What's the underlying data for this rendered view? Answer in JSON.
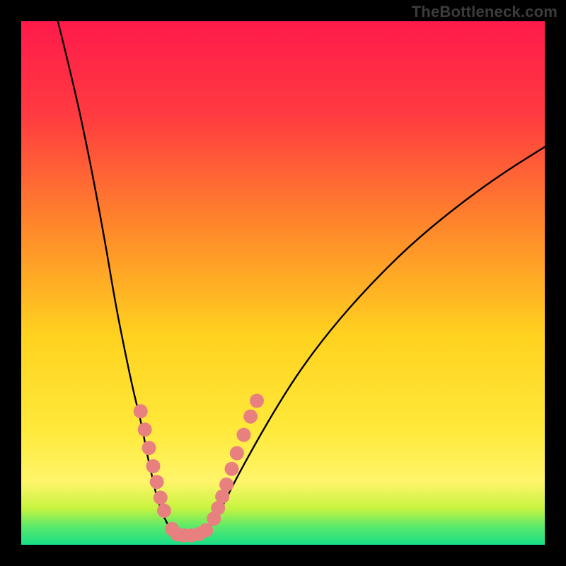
{
  "watermark": "TheBottleneck.com",
  "chart_data": {
    "type": "line",
    "title": "",
    "xlabel": "",
    "ylabel": "",
    "xlim": [
      0,
      100
    ],
    "ylim": [
      0,
      100
    ],
    "grid": false,
    "legend": false,
    "annotations": [],
    "background_gradient": {
      "stops": [
        {
          "offset": 0.0,
          "color": "#ff1a4b"
        },
        {
          "offset": 0.18,
          "color": "#ff3b40"
        },
        {
          "offset": 0.4,
          "color": "#ff8a2a"
        },
        {
          "offset": 0.6,
          "color": "#ffd21f"
        },
        {
          "offset": 0.78,
          "color": "#ffe93a"
        },
        {
          "offset": 0.88,
          "color": "#fff56a"
        },
        {
          "offset": 0.93,
          "color": "#c7f43f"
        },
        {
          "offset": 0.965,
          "color": "#5be96a"
        },
        {
          "offset": 1.0,
          "color": "#18df88"
        }
      ]
    },
    "series": [
      {
        "name": "curve-left",
        "x": [
          7,
          10,
          13,
          16,
          18,
          20,
          21.5,
          23,
          24,
          25,
          25.8,
          26.6,
          27.4,
          28.2,
          29
        ],
        "y": [
          100,
          88,
          74,
          58,
          46,
          36,
          29,
          23,
          17.5,
          13,
          9.5,
          7,
          5,
          3.5,
          2.5
        ]
      },
      {
        "name": "valley-floor",
        "x": [
          29,
          30,
          31,
          32,
          33,
          34,
          35
        ],
        "y": [
          2.5,
          2.0,
          1.8,
          1.8,
          1.9,
          2.1,
          2.6
        ]
      },
      {
        "name": "curve-right",
        "x": [
          35,
          36,
          37.5,
          39,
          41,
          44,
          48,
          53,
          59,
          66,
          74,
          83,
          92,
          100
        ],
        "y": [
          2.6,
          3.5,
          5.5,
          8.5,
          12.5,
          18,
          25,
          33,
          41,
          49,
          57,
          64.5,
          71,
          76
        ]
      }
    ],
    "markers": [
      {
        "x": 22.8,
        "y": 25.5
      },
      {
        "x": 23.6,
        "y": 22.0
      },
      {
        "x": 24.4,
        "y": 18.5
      },
      {
        "x": 25.2,
        "y": 15.0
      },
      {
        "x": 25.9,
        "y": 12.0
      },
      {
        "x": 26.6,
        "y": 9.0
      },
      {
        "x": 27.3,
        "y": 6.5
      },
      {
        "x": 28.8,
        "y": 3.0
      },
      {
        "x": 29.8,
        "y": 2.0
      },
      {
        "x": 31.0,
        "y": 1.8
      },
      {
        "x": 32.5,
        "y": 1.8
      },
      {
        "x": 34.0,
        "y": 2.1
      },
      {
        "x": 35.3,
        "y": 2.8
      },
      {
        "x": 36.8,
        "y": 5.0
      },
      {
        "x": 37.6,
        "y": 7.0
      },
      {
        "x": 38.4,
        "y": 9.2
      },
      {
        "x": 39.2,
        "y": 11.5
      },
      {
        "x": 40.2,
        "y": 14.5
      },
      {
        "x": 41.2,
        "y": 17.5
      },
      {
        "x": 42.5,
        "y": 21.0
      },
      {
        "x": 43.8,
        "y": 24.5
      },
      {
        "x": 45.0,
        "y": 27.5
      }
    ],
    "marker_style": {
      "color": "#e98080",
      "radius_px": 10
    }
  }
}
